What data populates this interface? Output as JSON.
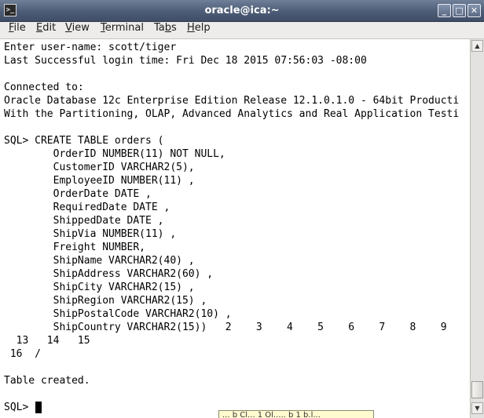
{
  "window": {
    "title": "oracle@ica:~",
    "app_icon": ">_",
    "minimize": "_",
    "maximize": "□",
    "close": "✕"
  },
  "menu": {
    "file_u": "F",
    "file_rest": "ile",
    "edit_u": "E",
    "edit_rest": "dit",
    "view_u": "V",
    "view_rest": "iew",
    "terminal_u": "T",
    "terminal_rest": "erminal",
    "tabs_pre": "Ta",
    "tabs_u": "b",
    "tabs_rest": "s",
    "help_u": "H",
    "help_rest": "elp"
  },
  "terminal": {
    "lines": [
      "Enter user-name: scott/tiger",
      "Last Successful login time: Fri Dec 18 2015 07:56:03 -08:00",
      "",
      "Connected to:",
      "Oracle Database 12c Enterprise Edition Release 12.1.0.1.0 - 64bit Producti",
      "With the Partitioning, OLAP, Advanced Analytics and Real Application Testi",
      "",
      "SQL> CREATE TABLE orders (",
      "        OrderID NUMBER(11) NOT NULL,",
      "        CustomerID VARCHAR2(5),",
      "        EmployeeID NUMBER(11) ,",
      "        OrderDate DATE ,",
      "        RequiredDate DATE ,",
      "        ShippedDate DATE ,",
      "        ShipVia NUMBER(11) ,",
      "        Freight NUMBER,",
      "        ShipName VARCHAR2(40) ,",
      "        ShipAddress VARCHAR2(60) ,",
      "        ShipCity VARCHAR2(15) ,",
      "        ShipRegion VARCHAR2(15) ,",
      "        ShipPostalCode VARCHAR2(10) ,",
      "        ShipCountry VARCHAR2(15))   2    3    4    5    6    7    8    9",
      "  13   14   15",
      " 16  /",
      "",
      "Table created.",
      "",
      "SQL> "
    ],
    "tooltip": "... b Cl... 1 Ol..... b 1 b.l..."
  },
  "scrollbar": {
    "up_arrow": "▲",
    "down_arrow": "▼"
  }
}
